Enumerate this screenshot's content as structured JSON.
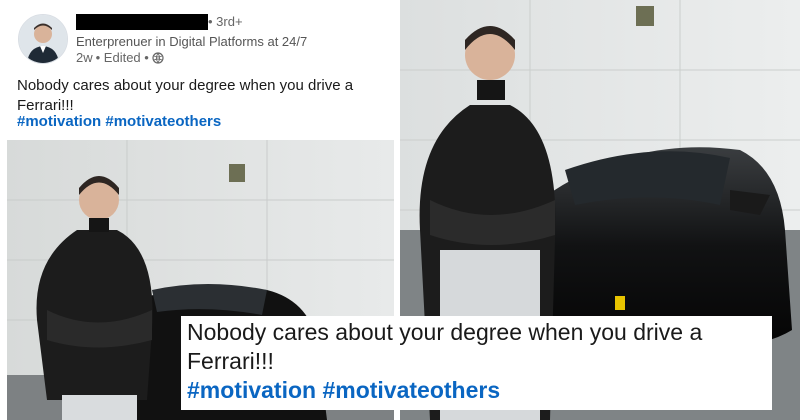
{
  "post": {
    "author_degree": "• 3rd+",
    "headline": "Enterprenuer in Digital Platforms at 24/7",
    "timestamp": "2w",
    "edited_label": "• Edited •",
    "visibility_icon": "globe-icon",
    "text": "Nobody cares about your degree when you drive a Ferrari!!!",
    "hashtags": [
      "#motivation",
      "#motivateothers"
    ]
  },
  "photo": {
    "subject": "man in black jacket with arms crossed in front of black Ferrari",
    "car_color": "#111111",
    "wall_color": "#e3e5e4"
  },
  "caption_overlay": {
    "text": "Nobody cares about your degree when you drive a Ferrari!!!",
    "hashtags": [
      "#motivation",
      "#motivateothers"
    ]
  },
  "colors": {
    "hashtag": "#0a66c2",
    "text": "#1a1a1a",
    "muted": "#666666"
  }
}
